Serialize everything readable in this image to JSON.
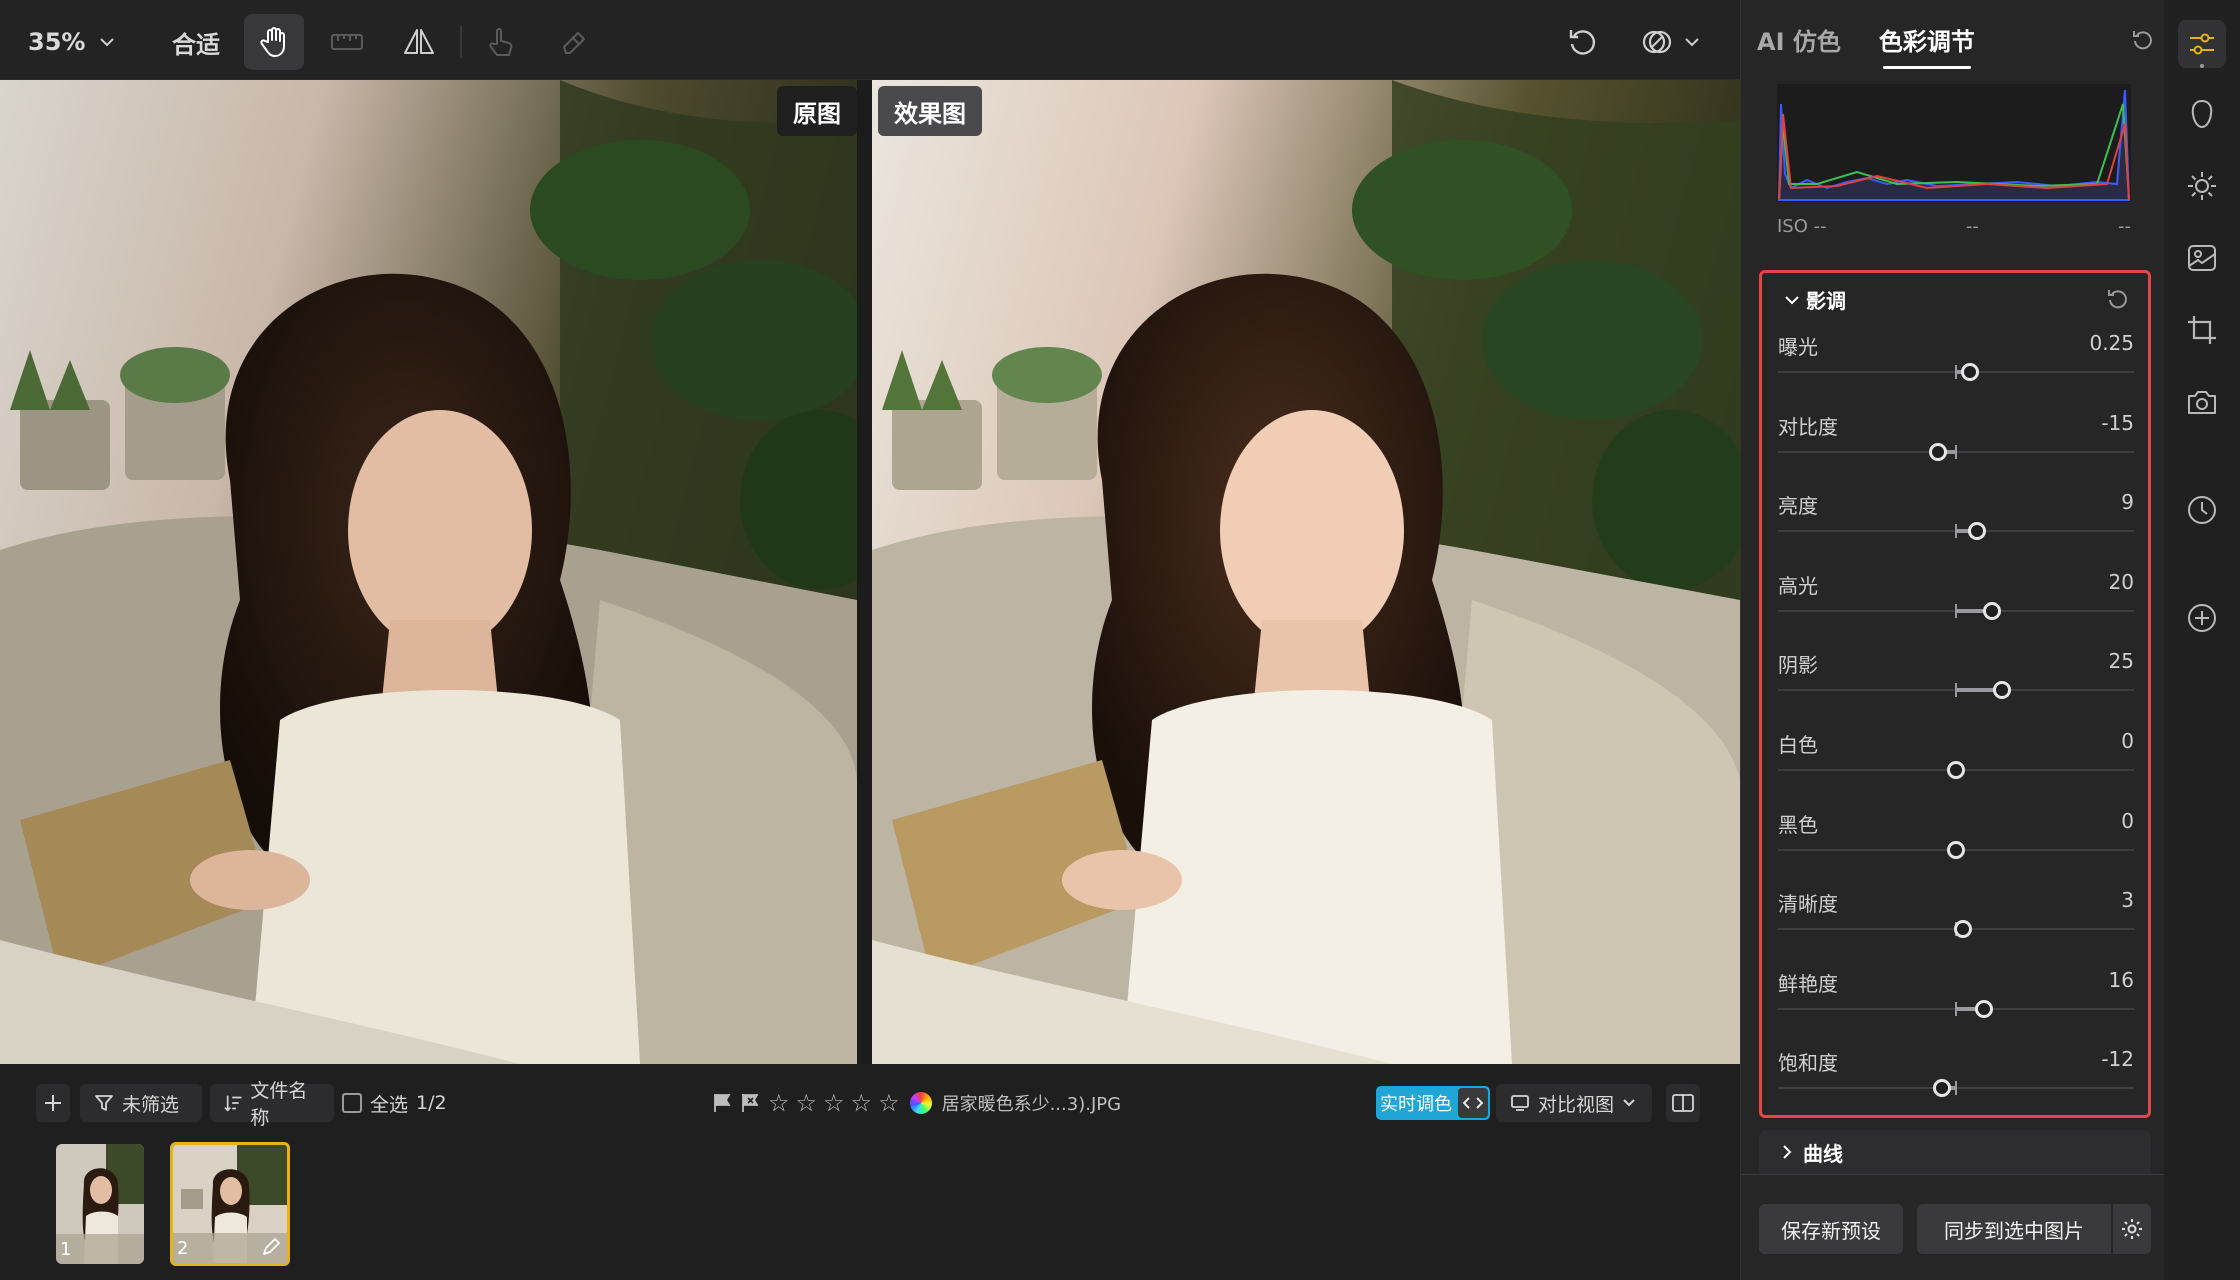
{
  "toolbar": {
    "zoom_value": "35%",
    "fit_label": "合适",
    "icons": [
      "hand-icon",
      "ruler-icon",
      "flip-icon",
      "touch-hand-icon",
      "eraser-icon",
      "undo-icon",
      "overlay-icon",
      "chevron-down-icon"
    ]
  },
  "viewer": {
    "original_label": "原图",
    "effect_label": "效果图"
  },
  "filmstrip": {
    "filter_label": "未筛选",
    "sort_label": "文件名称",
    "select_all_label": "全选",
    "select_count": "1/2",
    "filename": "居家暖色系少...3).JPG",
    "rating_stars": 5,
    "live_label": "实时调色",
    "compare_label": "对比视图",
    "thumbnails": [
      {
        "number": "1",
        "selected": false
      },
      {
        "number": "2",
        "selected": true
      }
    ]
  },
  "panel": {
    "tab_ai": "AI 仿色",
    "tab_color": "色彩调节",
    "iso": {
      "label": "ISO --",
      "mid": "--",
      "right": "--"
    },
    "tone": {
      "title": "影调",
      "sliders": [
        {
          "label": "曝光",
          "value": "0.25",
          "pos": 0.54
        },
        {
          "label": "对比度",
          "value": "-15",
          "pos": 0.45
        },
        {
          "label": "亮度",
          "value": "9",
          "pos": 0.56
        },
        {
          "label": "高光",
          "value": "20",
          "pos": 0.6
        },
        {
          "label": "阴影",
          "value": "25",
          "pos": 0.63
        },
        {
          "label": "白色",
          "value": "0",
          "pos": 0.5
        },
        {
          "label": "黑色",
          "value": "0",
          "pos": 0.5
        },
        {
          "label": "清晰度",
          "value": "3",
          "pos": 0.52
        },
        {
          "label": "鲜艳度",
          "value": "16",
          "pos": 0.58
        },
        {
          "label": "饱和度",
          "value": "-12",
          "pos": 0.46
        }
      ]
    },
    "curve_label": "曲线",
    "save_preset_label": "保存新预设",
    "sync_label": "同步到选中图片"
  },
  "colors": {
    "accent": "#e5b318",
    "highlight_box": "#e04848",
    "live_button": "#20a6d6"
  }
}
